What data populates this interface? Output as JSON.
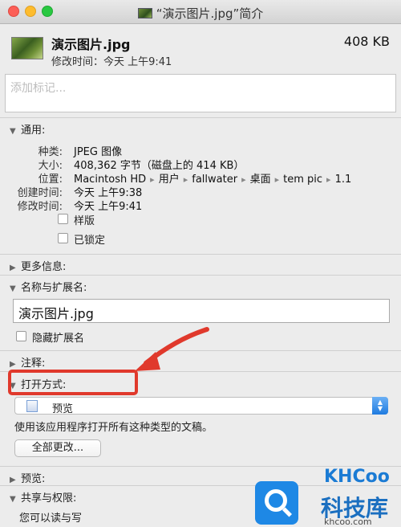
{
  "window": {
    "title": "“演示图片.jpg”简介"
  },
  "header": {
    "filename": "演示图片.jpg",
    "size": "408 KB",
    "modified": "修改时间：今天 上午9:41"
  },
  "tags": {
    "placeholder": "添加标记..."
  },
  "general": {
    "heading": "通用:",
    "kind_label": "种类:",
    "kind_value": "JPEG 图像",
    "size_label": "大小:",
    "size_value": "408,362 字节（磁盘上的 414 KB）",
    "where_label": "位置:",
    "path": [
      "Macintosh HD",
      "用户",
      "fallwater",
      "桌面",
      "tem pic",
      "1.1"
    ],
    "created_label": "创建时间:",
    "created_value": "今天 上午9:38",
    "modified_label": "修改时间:",
    "modified_value": "今天 上午9:41",
    "stationery_label": "样版",
    "locked_label": "已锁定"
  },
  "more_info": {
    "heading": "更多信息:"
  },
  "name_ext": {
    "heading": "名称与扩展名:",
    "value": "演示图片.jpg",
    "hide_ext_label": "隐藏扩展名"
  },
  "comments": {
    "heading": "注释:"
  },
  "open_with": {
    "heading": "打开方式:",
    "app": "预览",
    "hint": "使用该应用程序打开所有这种类型的文稿。",
    "change_all": "全部更改..."
  },
  "preview": {
    "heading": "预览:"
  },
  "sharing": {
    "heading": "共享与权限:",
    "status": "您可以读与写"
  },
  "watermark": {
    "brand": "KHCoo",
    "cn": "科技库",
    "url": "khcoo.com"
  },
  "colors": {
    "highlight": "#e0392c",
    "accent": "#1f7be0"
  }
}
